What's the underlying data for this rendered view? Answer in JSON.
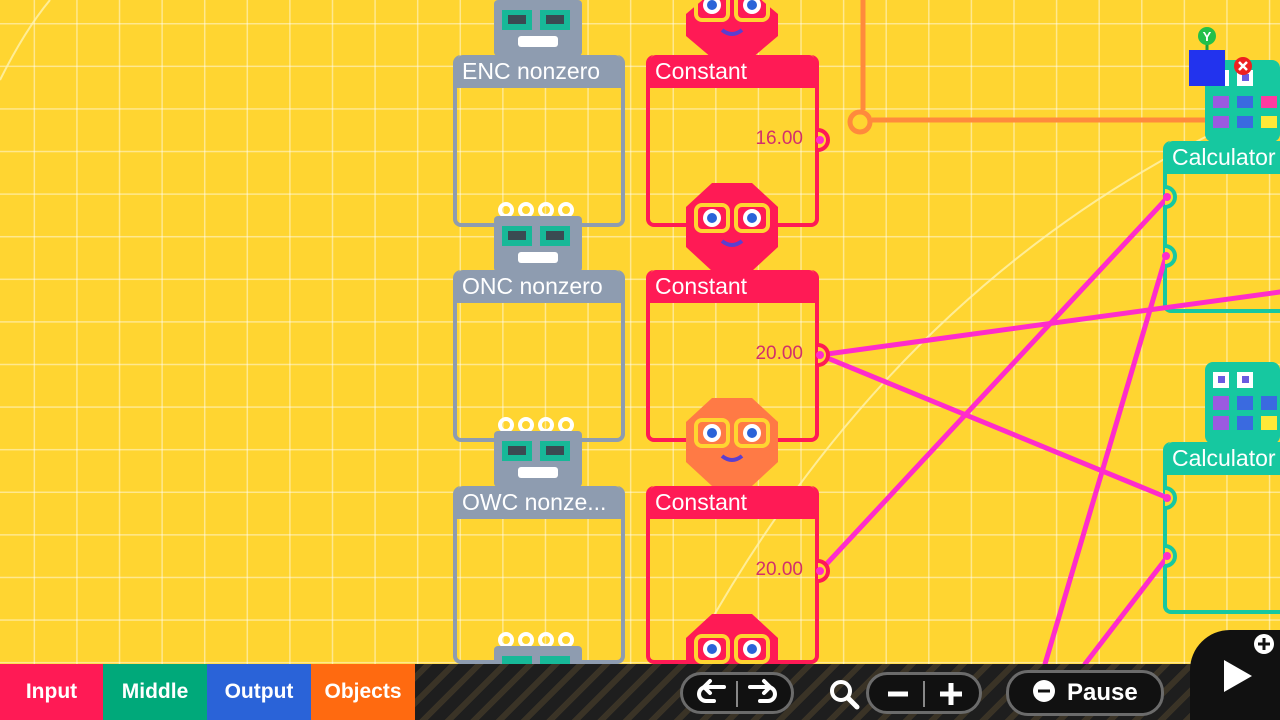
{
  "nodes": {
    "enc": {
      "title": "ENC nonzero"
    },
    "onc": {
      "title": "ONC nonzero"
    },
    "owc": {
      "title": "OWC nonze..."
    },
    "const1": {
      "title": "Constant",
      "value": "16.00"
    },
    "const2": {
      "title": "Constant",
      "value": "20.00"
    },
    "const3": {
      "title": "Constant",
      "value": "20.00"
    },
    "calc1": {
      "title": "Calculator"
    },
    "calc2": {
      "title": "Calculator"
    }
  },
  "axis_gizmo": {
    "y_label": "Y"
  },
  "toolbar": {
    "tabs": [
      {
        "label": "Input",
        "color": "#ff1a55"
      },
      {
        "label": "Middle",
        "color": "#00a97a"
      },
      {
        "label": "Output",
        "color": "#2a63d8"
      },
      {
        "label": "Objects",
        "color": "#ff6a10"
      }
    ],
    "pause_label": "Pause"
  },
  "colors": {
    "canvas": "#ffd531",
    "grey_node": "#8e9cb0",
    "constant_node": "#ff1a55",
    "calculator_node": "#16c8a0",
    "wire": "#ff2ccb",
    "orange_wire": "#ff8a3c"
  },
  "icons": [
    "undo-icon",
    "redo-icon",
    "zoom-icon",
    "zoom-out-icon",
    "zoom-in-icon",
    "pause-icon",
    "play-icon",
    "add-icon",
    "close-icon"
  ]
}
